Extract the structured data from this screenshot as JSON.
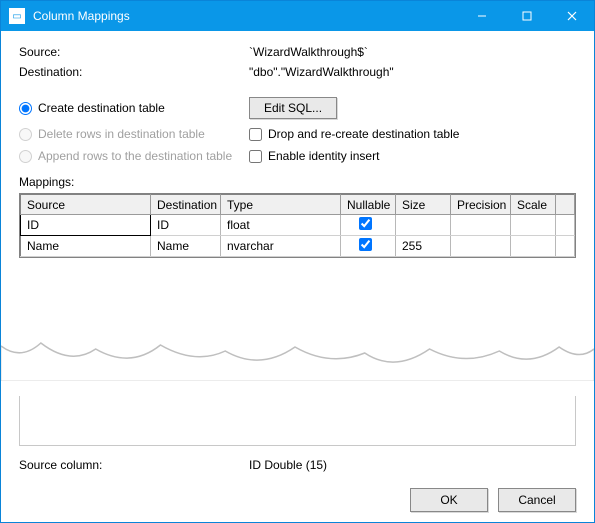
{
  "titlebar": {
    "title": "Column Mappings"
  },
  "source": {
    "label": "Source:",
    "value": "`WizardWalkthrough$`"
  },
  "destination": {
    "label": "Destination:",
    "value": "\"dbo\".\"WizardWalkthrough\""
  },
  "radios": {
    "create": "Create destination table",
    "delete": "Delete rows in destination table",
    "append": "Append rows to the destination table"
  },
  "editSql": {
    "label": "Edit SQL..."
  },
  "checks": {
    "drop": "Drop and re-create destination table",
    "identity": "Enable identity insert"
  },
  "mappingsLabel": "Mappings:",
  "columns": {
    "source": "Source",
    "destination": "Destination",
    "type": "Type",
    "nullable": "Nullable",
    "size": "Size",
    "precision": "Precision",
    "scale": "Scale"
  },
  "rows": [
    {
      "source": "ID",
      "destination": "ID",
      "type": "float",
      "nullable": true,
      "size": "",
      "precision": "",
      "scale": ""
    },
    {
      "source": "Name",
      "destination": "Name",
      "type": "nvarchar",
      "nullable": true,
      "size": "255",
      "precision": "",
      "scale": ""
    }
  ],
  "sourceColumn": {
    "label": "Source column:",
    "value": "ID Double (15)"
  },
  "buttons": {
    "ok": "OK",
    "cancel": "Cancel"
  }
}
